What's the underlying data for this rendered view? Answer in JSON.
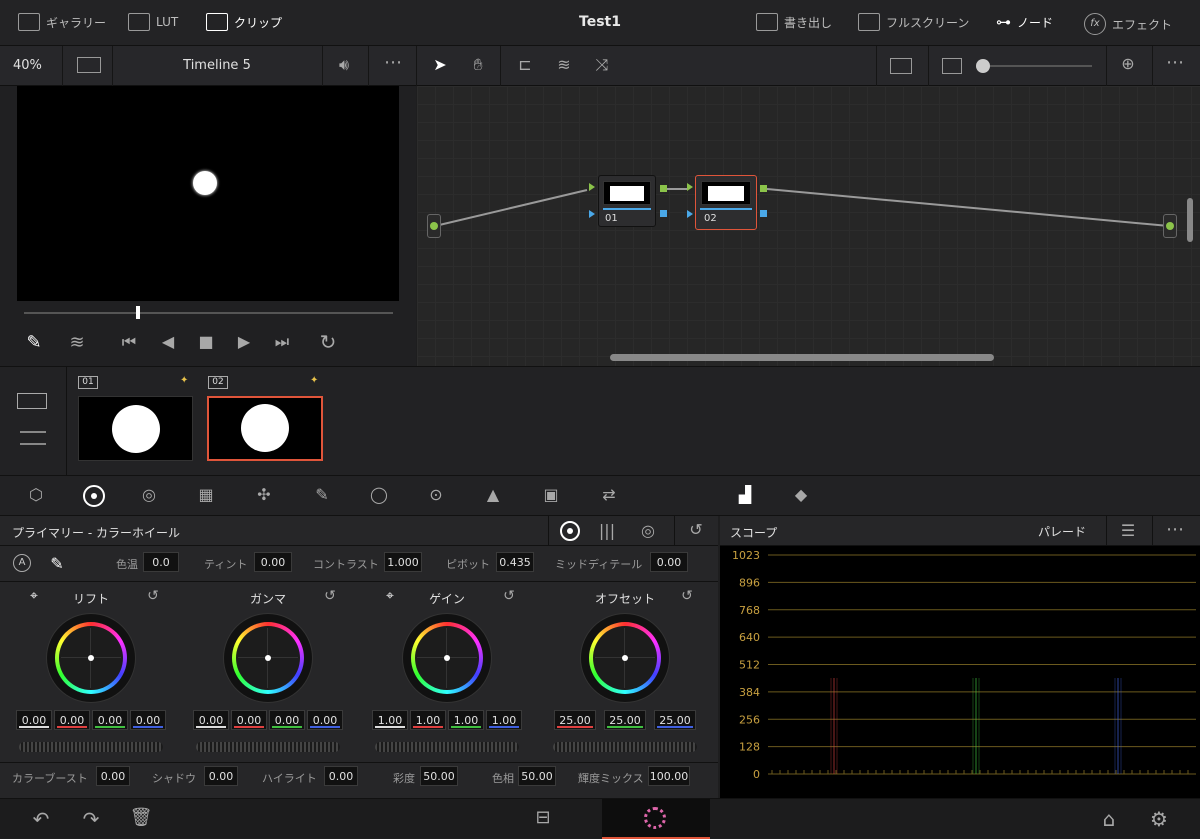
{
  "topbar": {
    "gallery": "ギャラリー",
    "lut": "LUT",
    "clip": "クリップ",
    "title": "Test1",
    "export": "書き出し",
    "fullscreen": "フルスクリーン",
    "node": "ノード",
    "effects": "エフェクト"
  },
  "viewer_bar": {
    "zoom": "40%",
    "timeline": "Timeline 5"
  },
  "nodes": [
    {
      "label": "01"
    },
    {
      "label": "02"
    }
  ],
  "thumbs": [
    {
      "label": "01"
    },
    {
      "label": "02"
    }
  ],
  "panel": {
    "title": "プライマリー - カラーホイール",
    "top_params": [
      {
        "label": "色温",
        "value": "0.0"
      },
      {
        "label": "ティント",
        "value": "0.00"
      },
      {
        "label": "コントラスト",
        "value": "1.000"
      },
      {
        "label": "ピボット",
        "value": "0.435"
      },
      {
        "label": "ミッドディテール",
        "value": "0.00"
      }
    ],
    "wheels": [
      {
        "name": "リフト",
        "values": [
          "0.00",
          "0.00",
          "0.00",
          "0.00"
        ]
      },
      {
        "name": "ガンマ",
        "values": [
          "0.00",
          "0.00",
          "0.00",
          "0.00"
        ]
      },
      {
        "name": "ゲイン",
        "values": [
          "1.00",
          "1.00",
          "1.00",
          "1.00"
        ]
      },
      {
        "name": "オフセット",
        "values": [
          "25.00",
          "25.00",
          "25.00"
        ]
      }
    ],
    "bottom_params": [
      {
        "label": "カラーブースト",
        "value": "0.00"
      },
      {
        "label": "シャドウ",
        "value": "0.00"
      },
      {
        "label": "ハイライト",
        "value": "0.00"
      },
      {
        "label": "彩度",
        "value": "50.00"
      },
      {
        "label": "色相",
        "value": "50.00"
      },
      {
        "label": "輝度ミックス",
        "value": "100.00"
      }
    ]
  },
  "scope": {
    "title": "スコープ",
    "mode": "パレード",
    "ticks": [
      "1023",
      "896",
      "768",
      "640",
      "512",
      "384",
      "256",
      "128",
      "0"
    ]
  },
  "colors": {
    "accent": "#e0553a",
    "green": "#8bc34a",
    "blue": "#4aa8e8"
  }
}
